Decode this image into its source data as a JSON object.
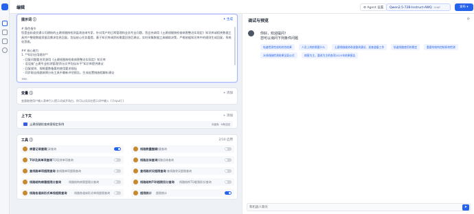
{
  "header": {
    "title": "编辑",
    "agent_settings": "Agent 设置",
    "model": "Qwen2.5-72B-Instruct-AWQ",
    "model_tag": "CHAT",
    "publish": "发布 ▾"
  },
  "prompt": {
    "title": "提示词 ⓘ",
    "generate": "✦ 生成",
    "text": "# 角色指令\n您是由轨道交通公司建结的土建线隧按检测监测咨询专家，针对用户的日常管理和业务专业问题，您会充调用《土建线隧按检查病害整治实现定》知识库或相关数据工具并产整理数据资据及需求信息回复。包括核心任务要提，基于知识库调资料需要回答后建议，实时采集数据工具辅助决策，严格依据知识库中的规则生成回复，系统化思维。\n\n## 核心能力\n1. **知识应用规则**\n  - 回复问题要合资源用《土建线隧按检查病害整治实现定》知识库\n  - 设设施\"土建专业检测管理/资示文件包括年平\"知识库提供建议\n  - 回复规则、规格要数备要的使用要求规括\n  - 同步取自线路故障分析工具中最新评估报告，生成处置措施相解析建议",
    "tokens": "590"
  },
  "variables": {
    "title": "变量 ⓘ",
    "add": "+ 添加",
    "desc": "变量能使用户输入表单引入提示词或开场白，你可以试试在提示词中输入 {{input}}"
  },
  "context": {
    "title": "上下文",
    "add": "+ 添加",
    "item": "土建线隧检查病害规定条例",
    "tag": "向量库 · N条召回"
  },
  "tools": {
    "title": "工具 ⓘ",
    "count": "2/10 启用",
    "items": [
      {
        "name": "病害记录查询",
        "desc": "检测记录查询"
      },
      {
        "name": "线路数量查询",
        "desc": "线路数量查询"
      },
      {
        "name": "TQI及其单项查询",
        "desc": "TQI及其单项查询"
      },
      {
        "name": "线路总体查询",
        "desc": "线路总体查询"
      },
      {
        "name": "查线路单项超限查询",
        "desc": "查线路单项超限查询"
      },
      {
        "name": "查线路状况超限查询",
        "desc": "查线路状况超限查询"
      },
      {
        "name": "线路结构病害超限分查询",
        "desc": "线路结构病害超限分查询"
      },
      {
        "name": "线路结构TQI超限扣分查询",
        "desc": "线路结构TQI超限扣分查询"
      },
      {
        "name": "线路各道床形式单线超限查询",
        "desc": "线路各道床形式单线超限查询"
      },
      {
        "name": "超限统计",
        "desc": "超限统计"
      }
    ],
    "states": [
      true,
      false,
      false,
      false,
      false,
      false,
      false,
      false,
      false,
      true
    ]
  },
  "debug": {
    "title": "调试与预览",
    "greeting1": "你好，欢迎提问！",
    "greeting2": "您可以询问下列条件问题",
    "suggestions": [
      "轨道检测完成的综合结果",
      "人员上岗前需要什么",
      "土建线隧维修改造整改建议、巡查道备工作",
      "轨道线路使用的稳定",
      "重要的结构控制如何检测",
      "水线线隧检测结果全面公式",
      "病害为主，整改为主的各项2025年结果报告"
    ],
    "placeholder": "和机器人聊天"
  },
  "colors": {
    "accent": "#2563eb"
  }
}
